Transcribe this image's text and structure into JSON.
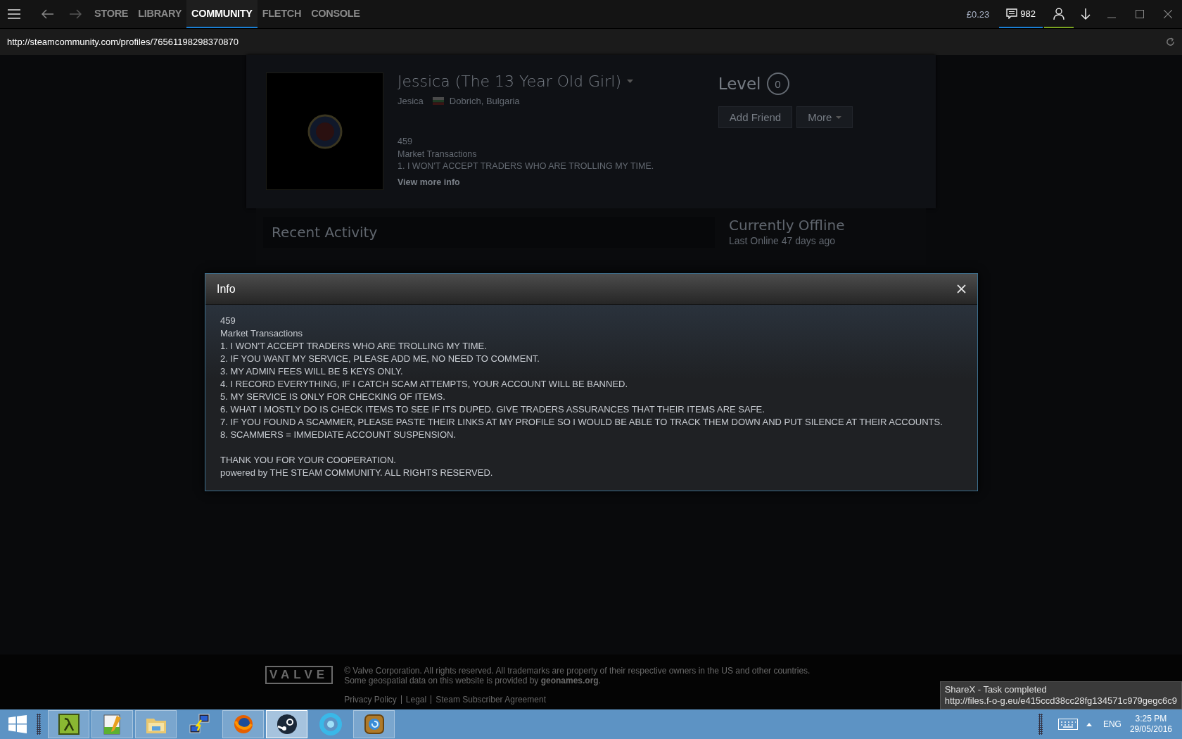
{
  "nav": {
    "tabs": [
      {
        "label": "STORE",
        "selected": false
      },
      {
        "label": "LIBRARY",
        "selected": false
      },
      {
        "label": "COMMUNITY",
        "selected": true
      },
      {
        "label": "FLETCH",
        "selected": false
      },
      {
        "label": "CONSOLE",
        "selected": false
      }
    ],
    "wallet": "£0.23",
    "notifications": "982"
  },
  "url": "http://steamcommunity.com/profiles/76561198298370870",
  "profile": {
    "name": "Jessica (The 13 Year Old Girl)",
    "real_name": "Jesica",
    "location": "Dobrich, Bulgaria",
    "summary": [
      "459",
      "Market Transactions",
      "1. I WON'T ACCEPT TRADERS WHO ARE TROLLING MY TIME."
    ],
    "view_more": "View more info",
    "level_label": "Level",
    "level_value": "0",
    "buttons": [
      {
        "label": "Add Friend",
        "dropdown": false
      },
      {
        "label": "More",
        "dropdown": true
      }
    ],
    "recent_activity": "Recent Activity",
    "status": "Currently Offline",
    "last_online": "Last Online 47 days ago"
  },
  "dialog": {
    "title": "Info",
    "paragraphs": [
      [
        "459",
        "Market Transactions",
        "1. I WON'T ACCEPT TRADERS WHO ARE TROLLING MY TIME.",
        "2. IF YOU WANT MY SERVICE, PLEASE ADD ME, NO NEED TO COMMENT.",
        "3. MY ADMIN FEES WILL BE 5 KEYS ONLY.",
        "4. I RECORD EVERYTHING, IF I CATCH SCAM ATTEMPTS, YOUR ACCOUNT WILL BE BANNED.",
        "5. MY SERVICE IS ONLY FOR CHECKING OF ITEMS.",
        "6. WHAT I MOSTLY DO IS CHECK ITEMS TO SEE IF ITS DUPED. GIVE TRADERS ASSURANCES THAT THEIR ITEMS ARE SAFE.",
        "7. IF YOU FOUND A SCAMMER, PLEASE PASTE THEIR LINKS AT MY PROFILE SO I WOULD BE ABLE TO TRACK THEM DOWN AND PUT SILENCE AT THEIR ACCOUNTS.",
        "8. SCAMMERS = IMMEDIATE ACCOUNT SUSPENSION."
      ],
      [
        "THANK YOU FOR YOUR COOPERATION.",
        "powered by THE STEAM COMMUNITY. ALL RIGHTS RESERVED."
      ]
    ]
  },
  "footer": {
    "logo": "VALVE",
    "copyright": "© Valve Corporation. All rights reserved. All trademarks are property of their respective owners in the US and other countries.",
    "geo_text": "Some geospatial data on this website is provided by",
    "geo_link": "geonames.org",
    "geo_after": ".",
    "links": [
      "Privacy Policy",
      "Legal",
      "Steam Subscriber Agreement"
    ]
  },
  "toast": {
    "title": "ShareX - Task completed",
    "url": "http://files.f-o-g.eu/e415ccd38cc28fg134571c979gegc6c9"
  },
  "taskbar": {
    "apps": [
      {
        "kind": "lambda",
        "running": true,
        "selected": false
      },
      {
        "kind": "notepad",
        "running": true,
        "selected": false
      },
      {
        "kind": "folder",
        "running": true,
        "selected": false
      },
      {
        "kind": "network",
        "running": false,
        "selected": false
      },
      {
        "kind": "firefox",
        "running": true,
        "selected": false
      },
      {
        "kind": "steam",
        "running": true,
        "selected": true
      },
      {
        "kind": "aperture",
        "running": false,
        "selected": false
      },
      {
        "kind": "hearthstone",
        "running": true,
        "selected": false
      }
    ],
    "language": "ENG",
    "time": "3:25 PM",
    "date": "29/05/2016"
  }
}
